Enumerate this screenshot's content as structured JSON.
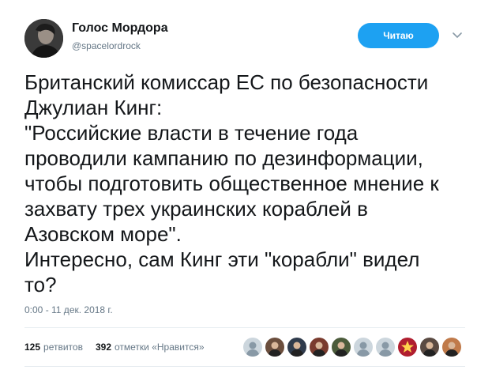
{
  "user": {
    "display_name": "Голос Мордора",
    "handle": "@spacelordrock",
    "avatar_icon": "person-portrait-icon"
  },
  "follow_button": {
    "label": "Читаю",
    "color": "#1da1f2"
  },
  "tweet": {
    "lines": [
      "Британский комиссар ЕС по безопасности",
      "Джулиан Кинг:",
      "\"Российские власти в течение года",
      "проводили кампанию по дезинформации,",
      "чтобы подготовить общественное мнение к",
      "захвату трех украинских кораблей в",
      "Азовском море\".",
      "Интересно, сам Кинг эти \"корабли\" видел",
      "то?"
    ],
    "timestamp": "0:00 - 11 дек. 2018 г."
  },
  "stats": {
    "retweets_count": "125",
    "retweets_label": "ретвитов",
    "likes_count": "392",
    "likes_label": "отметки «Нравится»"
  },
  "likers": [
    {
      "icon": "default-avatar-icon",
      "color": "#8899a6"
    },
    {
      "icon": "person-avatar-icon",
      "color": "#6b4e3d"
    },
    {
      "icon": "person-avatar-icon",
      "color": "#2f3b4c"
    },
    {
      "icon": "person-avatar-icon",
      "color": "#7a3b2e"
    },
    {
      "icon": "person-avatar-icon",
      "color": "#4b5b3a"
    },
    {
      "icon": "default-avatar-icon",
      "color": "#8899a6"
    },
    {
      "icon": "default-avatar-icon",
      "color": "#8899a6"
    },
    {
      "icon": "star-avatar-icon",
      "color": "#b01e2f"
    },
    {
      "icon": "person-avatar-icon",
      "color": "#5a4a42"
    },
    {
      "icon": "person-avatar-icon",
      "color": "#c07a4a"
    }
  ]
}
